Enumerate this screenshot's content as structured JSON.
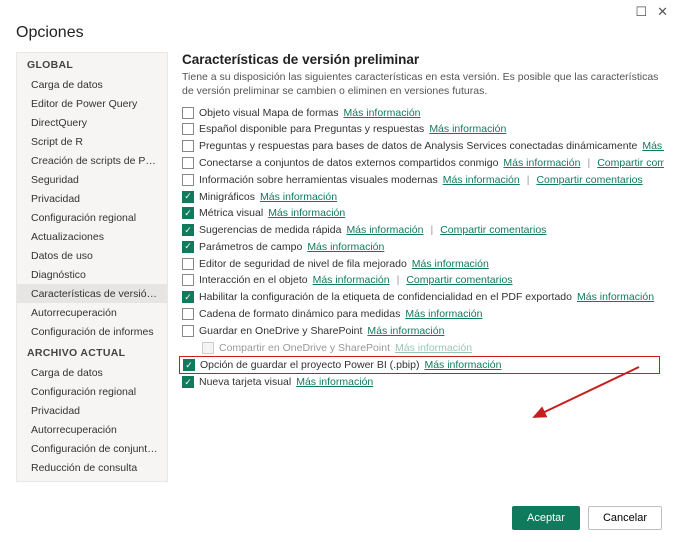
{
  "window": {
    "title": "Opciones",
    "maximize_icon": "☐",
    "close_icon": "✕"
  },
  "sidebar": {
    "groups": [
      {
        "label": "GLOBAL",
        "items": [
          {
            "label": "Carga de datos",
            "selected": false
          },
          {
            "label": "Editor de Power Query",
            "selected": false
          },
          {
            "label": "DirectQuery",
            "selected": false
          },
          {
            "label": "Script de R",
            "selected": false
          },
          {
            "label": "Creación de scripts de Python",
            "selected": false
          },
          {
            "label": "Seguridad",
            "selected": false
          },
          {
            "label": "Privacidad",
            "selected": false
          },
          {
            "label": "Configuración regional",
            "selected": false
          },
          {
            "label": "Actualizaciones",
            "selected": false
          },
          {
            "label": "Datos de uso",
            "selected": false
          },
          {
            "label": "Diagnóstico",
            "selected": false
          },
          {
            "label": "Características de versión prelimi...",
            "selected": true
          },
          {
            "label": "Autorrecuperación",
            "selected": false
          },
          {
            "label": "Configuración de informes",
            "selected": false
          }
        ]
      },
      {
        "label": "ARCHIVO ACTUAL",
        "items": [
          {
            "label": "Carga de datos",
            "selected": false
          },
          {
            "label": "Configuración regional",
            "selected": false
          },
          {
            "label": "Privacidad",
            "selected": false
          },
          {
            "label": "Autorrecuperación",
            "selected": false
          },
          {
            "label": "Configuración de conjunto de da...",
            "selected": false
          },
          {
            "label": "Reducción de consulta",
            "selected": false
          },
          {
            "label": "Configuración de informes",
            "selected": false
          }
        ]
      }
    ]
  },
  "main": {
    "heading": "Características de versión preliminar",
    "intro": "Tiene a su disposición las siguientes características en esta versión. Es posible que las características de versión preliminar se cambien o eliminen en versiones futuras.",
    "link_more": "Más información",
    "link_share": "Compartir comentarios",
    "features": [
      {
        "checked": false,
        "label": "Objeto visual Mapa de formas",
        "links": [
          "more"
        ]
      },
      {
        "checked": false,
        "label": "Español disponible para Preguntas y respuestas",
        "links": [
          "more"
        ]
      },
      {
        "checked": false,
        "label": "Preguntas y respuestas para bases de datos de Analysis Services conectadas dinámicamente",
        "links": [
          "more"
        ]
      },
      {
        "checked": false,
        "label": "Conectarse a conjuntos de datos externos compartidos conmigo",
        "links": [
          "more",
          "share"
        ]
      },
      {
        "checked": false,
        "label": "Información sobre herramientas visuales modernas",
        "links": [
          "more",
          "share"
        ]
      },
      {
        "checked": true,
        "label": "Minigráficos",
        "links": [
          "more"
        ]
      },
      {
        "checked": true,
        "label": "Métrica visual",
        "links": [
          "more"
        ]
      },
      {
        "checked": true,
        "label": "Sugerencias de medida rápida",
        "links": [
          "more",
          "share"
        ]
      },
      {
        "checked": true,
        "label": "Parámetros de campo",
        "links": [
          "more"
        ]
      },
      {
        "checked": false,
        "label": "Editor de seguridad de nivel de fila mejorado",
        "links": [
          "more"
        ]
      },
      {
        "checked": false,
        "label": "Interacción en el objeto",
        "links": [
          "more",
          "share"
        ]
      },
      {
        "checked": true,
        "label": "Habilitar la configuración de la etiqueta de confidencialidad en el PDF exportado",
        "links": [
          "more"
        ]
      },
      {
        "checked": false,
        "label": "Cadena de formato dinámico para medidas",
        "links": [
          "more"
        ]
      },
      {
        "checked": false,
        "label": "Guardar en OneDrive y SharePoint",
        "links": [
          "more"
        ]
      },
      {
        "checked": false,
        "label": "Compartir en OneDrive y SharePoint",
        "links": [
          "more"
        ],
        "indent": true,
        "disabled": true
      },
      {
        "checked": true,
        "label": "Opción de guardar el proyecto Power BI (.pbip)",
        "links": [
          "more"
        ],
        "highlight": true
      },
      {
        "checked": true,
        "label": "Nueva tarjeta visual",
        "links": [
          "more"
        ]
      }
    ]
  },
  "footer": {
    "ok": "Aceptar",
    "cancel": "Cancelar"
  }
}
